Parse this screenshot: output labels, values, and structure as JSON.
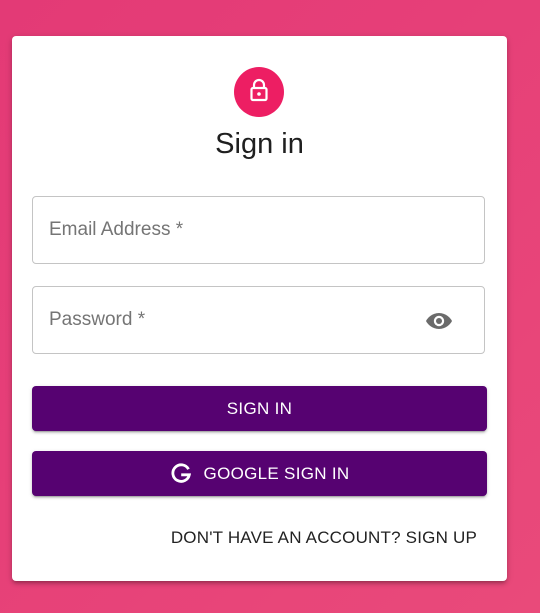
{
  "colors": {
    "background": "#e63f78",
    "avatar": "#ed1e63",
    "button": "#560271",
    "card": "#ffffff"
  },
  "header": {
    "icon": "lock-icon",
    "title": "Sign in"
  },
  "form": {
    "email": {
      "placeholder": "Email Address *",
      "value": ""
    },
    "password": {
      "placeholder": "Password *",
      "value": "",
      "toggle_icon": "eye-icon"
    },
    "signin_label": "SIGN IN",
    "google_label": "GOOGLE SIGN IN",
    "google_icon": "google-icon",
    "signup_link": "DON'T HAVE AN ACCOUNT? SIGN UP"
  }
}
